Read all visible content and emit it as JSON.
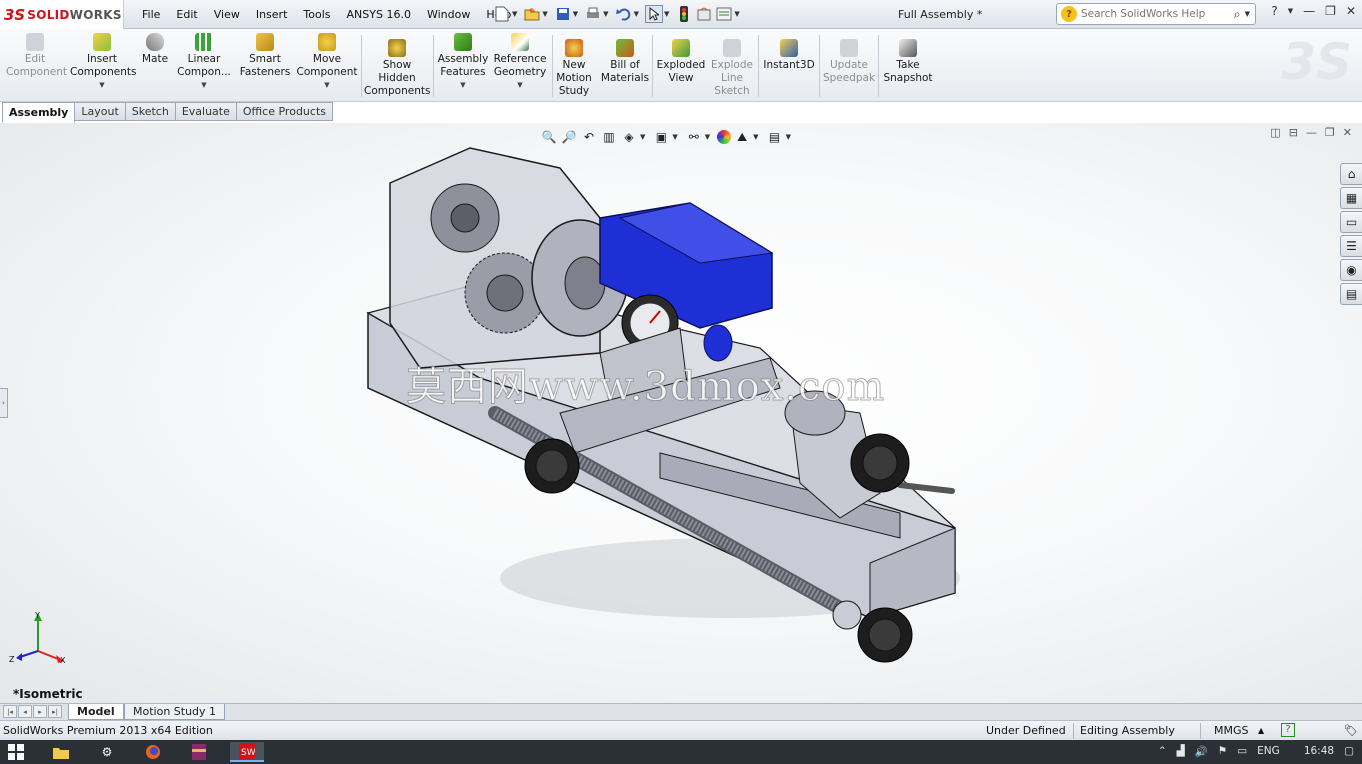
{
  "app": {
    "logo_ds": "3S",
    "logo_brand_a": "SOLID",
    "logo_brand_b": "WORKS",
    "document_title": "Full Assembly *"
  },
  "menu": [
    "File",
    "Edit",
    "View",
    "Insert",
    "Tools",
    "ANSYS 16.0",
    "Window",
    "Help"
  ],
  "search": {
    "placeholder": "Search SolidWorks Help"
  },
  "commands": {
    "edit_component": [
      "Edit",
      "Component"
    ],
    "insert_components": [
      "Insert",
      "Components"
    ],
    "mate": [
      "Mate"
    ],
    "linear_pattern": [
      "Linear",
      "Compon..."
    ],
    "smart_fasteners": [
      "Smart",
      "Fasteners"
    ],
    "move_component": [
      "Move",
      "Component"
    ],
    "show_hidden": [
      "Show",
      "Hidden",
      "Components"
    ],
    "assembly_features": [
      "Assembly",
      "Features"
    ],
    "reference_geometry": [
      "Reference",
      "Geometry"
    ],
    "new_motion_study": [
      "New",
      "Motion",
      "Study"
    ],
    "bill_of_materials": [
      "Bill of",
      "Materials"
    ],
    "exploded_view": [
      "Exploded",
      "View"
    ],
    "explode_line_sketch": [
      "Explode",
      "Line",
      "Sketch"
    ],
    "instant3d": [
      "Instant3D"
    ],
    "update_speedpak": [
      "Update",
      "Speedpak"
    ],
    "take_snapshot": [
      "Take",
      "Snapshot"
    ]
  },
  "tabs": [
    "Assembly",
    "Layout",
    "Sketch",
    "Evaluate",
    "Office Products"
  ],
  "viewport": {
    "view_name": "*Isometric",
    "watermark": "莫西网www.3dmox.com",
    "triad": {
      "x": "X",
      "y": "Y",
      "z": "Z"
    },
    "colors": {
      "part_gray": "#c9cbd6",
      "motor_blue": "#1f2fd6",
      "edge": "#1a1a1a"
    }
  },
  "bottom_tabs": [
    "Model",
    "Motion Study 1"
  ],
  "status": {
    "edition": "SolidWorks Premium 2013 x64 Edition",
    "state": "Under Defined",
    "mode": "Editing Assembly",
    "units": "MMGS"
  },
  "taskbar": {
    "language": "ENG",
    "time": "16:48"
  }
}
